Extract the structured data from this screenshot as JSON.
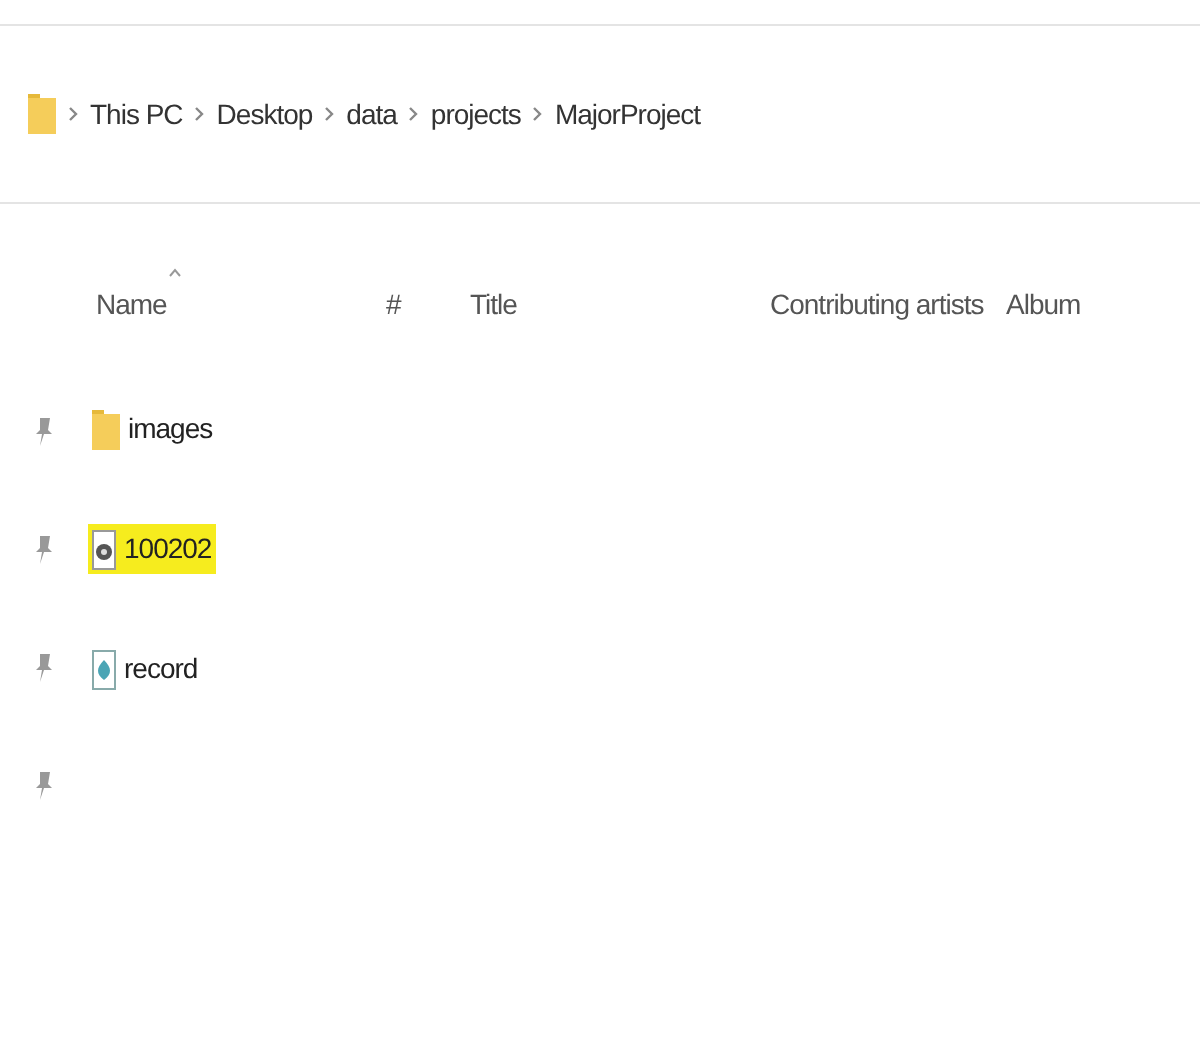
{
  "breadcrumb": [
    "This PC",
    "Desktop",
    "data",
    "projects",
    "MajorProject"
  ],
  "columns": [
    "Name",
    "#",
    "Title",
    "Contributing artists",
    "Album"
  ],
  "files": [
    {
      "name": "images",
      "kind": "folder",
      "highlighted": false
    },
    {
      "name": "100202",
      "kind": "disc",
      "highlighted": true
    },
    {
      "name": "record",
      "kind": "document",
      "highlighted": false
    }
  ]
}
